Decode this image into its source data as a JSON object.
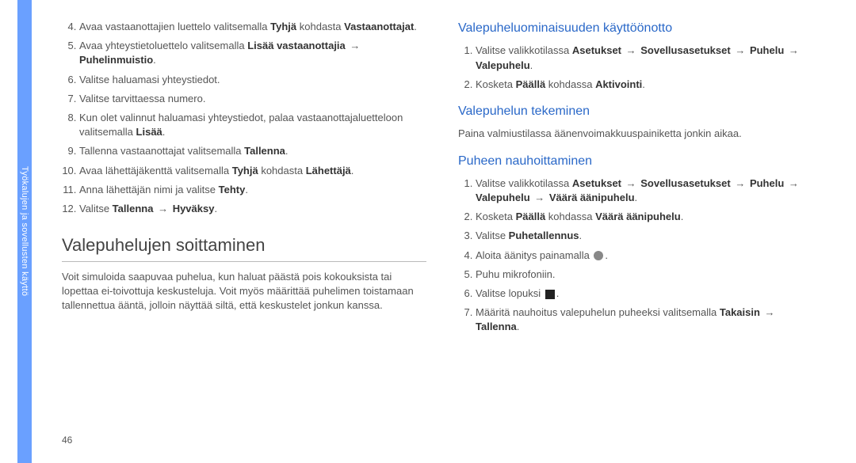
{
  "sidebar": {
    "label": "Työkalujen ja sovellusten käyttö"
  },
  "page_number": "46",
  "arrow_glyph": "→",
  "left": {
    "list_a": {
      "start": 4,
      "items": [
        {
          "pre": "Avaa vastaanottajien luettelo valitsemalla ",
          "b1": "Tyhjä",
          "mid1": " kohdasta ",
          "b2": "Vastaanottajat",
          "post": "."
        },
        {
          "pre": "Avaa yhteystietoluettelo valitsemalla ",
          "b1": "Lisää vastaanottajia",
          "arrow": true,
          "b2": "Puhelinmuistio",
          "post": "."
        },
        {
          "plain": "Valitse haluamasi yhteystiedot."
        },
        {
          "plain": "Valitse tarvittaessa numero."
        },
        {
          "pre": "Kun olet valinnut haluamasi yhteystiedot, palaa vastaanottajaluetteloon valitsemalla ",
          "b1": "Lisää",
          "post": "."
        },
        {
          "pre": "Tallenna vastaanottajat valitsemalla ",
          "b1": "Tallenna",
          "post": "."
        },
        {
          "pre": "Avaa lähettäjäkenttä valitsemalla ",
          "b1": "Tyhjä",
          "mid1": " kohdasta ",
          "b2": "Lähettäjä",
          "post": "."
        },
        {
          "pre": "Anna lähettäjän nimi ja valitse ",
          "b1": "Tehty",
          "post": "."
        },
        {
          "pre": "Valitse ",
          "b1": "Tallenna",
          "arrow": true,
          "b2": "Hyväksy",
          "post": "."
        }
      ]
    },
    "section_title": "Valepuhelujen soittaminen",
    "intro": "Voit simuloida saapuvaa puhelua, kun haluat päästä pois kokouksista tai lopettaa ei-toivottuja keskusteluja. Voit myös määrittää puhelimen toistamaan tallennettua ääntä, jolloin näyttää siltä, että keskustelet jonkun kanssa."
  },
  "right": {
    "sub1": {
      "title": "Valepuheluominaisuuden käyttöönotto",
      "items": [
        {
          "pre": "Valitse valikkotilassa ",
          "b1": "Asetukset",
          "arrow1": true,
          "b2": "Sovellusasetukset",
          "arrow2": true,
          "b3": "Puhelu",
          "arrow3": true,
          "b4": "Valepuhelu",
          "post": "."
        },
        {
          "pre": "Kosketa ",
          "b1": "Päällä",
          "mid1": " kohdassa ",
          "b2": "Aktivointi",
          "post": "."
        }
      ]
    },
    "sub2": {
      "title": "Valepuhelun tekeminen",
      "text": "Paina valmiustilassa äänenvoimakkuuspainiketta jonkin aikaa."
    },
    "sub3": {
      "title": "Puheen nauhoittaminen",
      "items": [
        {
          "pre": "Valitse valikkotilassa ",
          "b1": "Asetukset",
          "arrow1": true,
          "b2": "Sovellusasetukset",
          "arrow2": true,
          "b3": "Puhelu",
          "arrow3": true,
          "b4": "Valepuhelu",
          "arrow4": true,
          "b5": "Väärä äänipuhelu",
          "post": "."
        },
        {
          "pre": "Kosketa ",
          "b1": "Päällä",
          "mid1": " kohdassa ",
          "b2": "Väärä äänipuhelu",
          "post": "."
        },
        {
          "pre": "Valitse ",
          "b1": "Puhetallennus",
          "post": "."
        },
        {
          "pre": "Aloita äänitys painamalla ",
          "icon": "circle",
          "post": "."
        },
        {
          "plain": "Puhu mikrofoniin."
        },
        {
          "pre": "Valitse lopuksi ",
          "icon": "square",
          "post": "."
        },
        {
          "pre": "Määritä nauhoitus valepuhelun puheeksi valitsemalla ",
          "b1": "Takaisin",
          "arrow1": true,
          "b2": "Tallenna",
          "post": "."
        }
      ]
    }
  }
}
